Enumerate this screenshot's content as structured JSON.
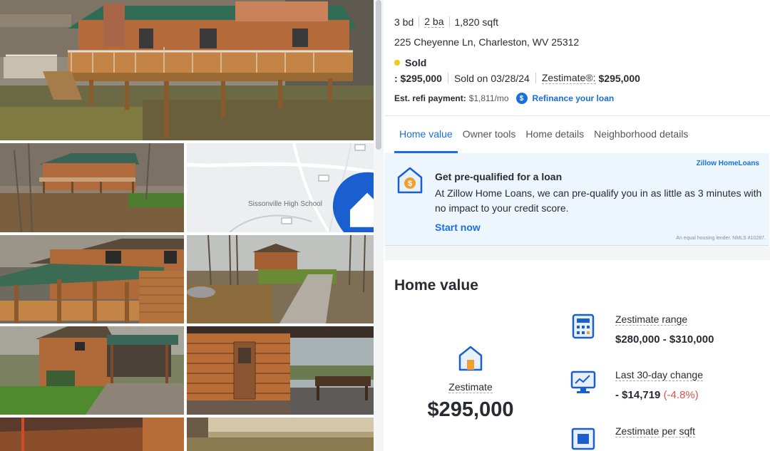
{
  "listing": {
    "beds": "3 bd",
    "baths": "2 ba",
    "sqft": "1,820 sqft",
    "address": "225 Cheyenne Ln, Charleston, WV 25312",
    "status": "Sold",
    "status_color": "#f5c518",
    "sold_price": ": $295,000",
    "sold_date": "Sold on 03/28/24",
    "zestimate_label": "Zestimate®:",
    "zestimate_value": "$295,000",
    "refi_label": "Est. refi payment:",
    "refi_value": "$1,811/mo",
    "refi_link": "Refinance your loan"
  },
  "map": {
    "label": "Sissonville High School"
  },
  "tabs": [
    {
      "label": "Home value",
      "active": true
    },
    {
      "label": "Owner tools",
      "active": false
    },
    {
      "label": "Home details",
      "active": false
    },
    {
      "label": "Neighborhood details",
      "active": false
    }
  ],
  "loan_card": {
    "brand": "Zillow HomeLoans",
    "title": "Get pre-qualified for a loan",
    "body": "At Zillow Home Loans, we can pre-qualify you in as little as 3 minutes with no impact to your credit score.",
    "cta": "Start now",
    "fine_print": "An equal housing lender. NMLS #10287."
  },
  "home_value": {
    "title": "Home value",
    "zestimate_label": "Zestimate",
    "zestimate_amount": "$295,000",
    "metrics": [
      {
        "icon": "calculator-icon",
        "label": "Zestimate range",
        "value": "$280,000 - $310,000",
        "change": ""
      },
      {
        "icon": "monitor-chart-icon",
        "label": "Last 30-day change",
        "value": "- $14,719",
        "change": "(-4.8%)"
      },
      {
        "icon": "ruler-house-icon",
        "label": "Zestimate per sqft",
        "value": "",
        "change": ""
      }
    ]
  },
  "colors": {
    "accent": "#1a6fe0",
    "negative": "#d9534f",
    "card_bg": "#eef6fd"
  }
}
